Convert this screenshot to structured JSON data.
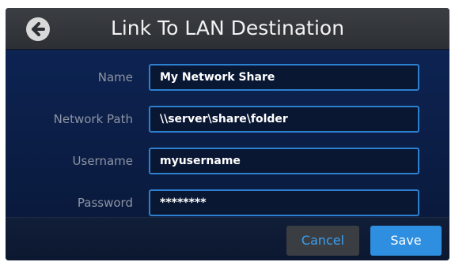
{
  "header": {
    "title": "Link To LAN Destination",
    "back_icon": "arrow-left-circle-icon"
  },
  "form": {
    "fields": [
      {
        "label": "Name",
        "value": "My Network Share"
      },
      {
        "label": "Network Path",
        "value": "\\\\server\\share\\folder"
      },
      {
        "label": "Username",
        "value": "myusername"
      },
      {
        "label": "Password",
        "value": "********"
      }
    ]
  },
  "footer": {
    "cancel_label": "Cancel",
    "save_label": "Save"
  },
  "colors": {
    "background": "#0b1b3e",
    "header": "#2c2f34",
    "accent": "#2e8fe0",
    "field_border": "#2d7fd0",
    "label": "#8d94a3"
  }
}
